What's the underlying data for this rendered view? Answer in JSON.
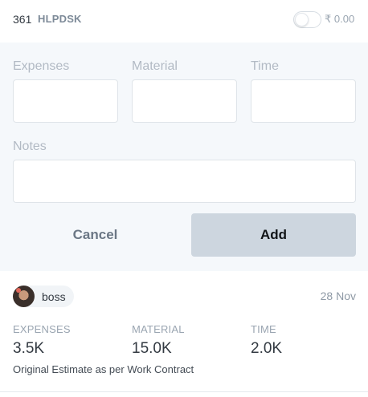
{
  "header": {
    "ticket_number": "361",
    "ticket_code": "HLPDSK",
    "amount": "₹ 0.00"
  },
  "form": {
    "expenses_label": "Expenses",
    "material_label": "Material",
    "time_label": "Time",
    "notes_label": "Notes",
    "expenses_value": "",
    "material_value": "",
    "time_value": "",
    "notes_value": "",
    "cancel_label": "Cancel",
    "add_label": "Add"
  },
  "entry": {
    "user_name": "boss",
    "date": "28 Nov",
    "expenses_label": "EXPENSES",
    "expenses_value": "3.5K",
    "material_label": "MATERIAL",
    "material_value": "15.0K",
    "time_label": "TIME",
    "time_value": "2.0K",
    "note": "Original Estimate as per Work Contract"
  },
  "colors": {
    "panel_bg": "#f5f8fb",
    "add_button_bg": "#cdd6df",
    "muted_text": "#9aa5b1"
  }
}
